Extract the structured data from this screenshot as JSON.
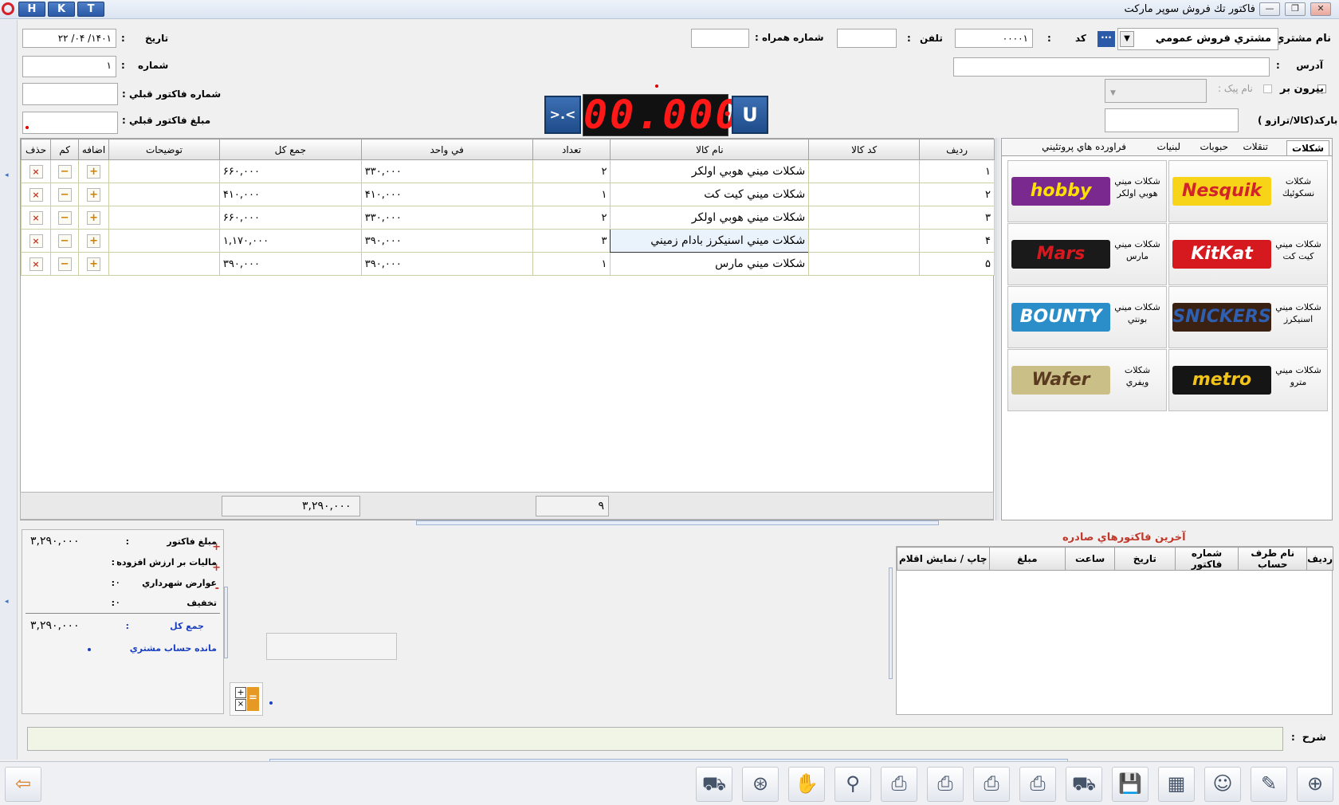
{
  "window": {
    "title": "فاكتور تك فروش سوپر ماركت",
    "hkt_buttons": [
      "H",
      "K",
      "T"
    ]
  },
  "header": {
    "customer_name_label": "نام مشتري :",
    "customer_name_value": "مشتري فروش عمومي",
    "code_label": "كد",
    "code_colon": ":",
    "code_value": "۰۰۰۰۱",
    "phone_label": "تلفن",
    "phone_colon": ":",
    "mobile_label": "شماره همراه :",
    "date_label": "تاريخ",
    "date_colon": ":",
    "date_value": "۱۴۰۱/ ۰۴/ ۲۲",
    "number_label": "شماره",
    "number_colon": ":",
    "number_value": "۱",
    "address_label": "آدرس",
    "address_colon": ":",
    "prev_invoice_number_label": "شماره فاكتور قبلي :",
    "prev_invoice_amount_label": "مبلغ فاكتور قبلي :",
    "outside_label": "بيرون بر",
    "courier_label": "نام پيک :",
    "barcode_label": "باركد(كالا/ترازو )",
    "led_value": "00.000",
    "left_btn_label": ">.<",
    "right_btn_label": "U"
  },
  "grid": {
    "columns": [
      "رديف",
      "كد كالا",
      "نام كالا",
      "تعداد",
      "في واحد",
      "جمع كل",
      "توضيحات",
      "اضافه",
      "كم",
      "حذف"
    ],
    "rows": [
      {
        "row": "۱",
        "code": "",
        "name": "شكلات ميني هوبي اولكر",
        "qty": "۲",
        "unit": "۳۳۰,۰۰۰",
        "total": "۶۶۰,۰۰۰",
        "desc": ""
      },
      {
        "row": "۲",
        "code": "",
        "name": "شكلات ميني كيت كت",
        "qty": "۱",
        "unit": "۴۱۰,۰۰۰",
        "total": "۴۱۰,۰۰۰",
        "desc": ""
      },
      {
        "row": "۳",
        "code": "",
        "name": "شكلات ميني هوبي اولكر",
        "qty": "۲",
        "unit": "۳۳۰,۰۰۰",
        "total": "۶۶۰,۰۰۰",
        "desc": ""
      },
      {
        "row": "۴",
        "code": "",
        "name": "شكلات ميني اسنيكرز بادام زميني",
        "qty": "۳",
        "unit": "۳۹۰,۰۰۰",
        "total": "۱,۱۷۰,۰۰۰",
        "desc": ""
      },
      {
        "row": "۵",
        "code": "",
        "name": "شكلات ميني مارس",
        "qty": "۱",
        "unit": "۳۹۰,۰۰۰",
        "total": "۳۹۰,۰۰۰",
        "desc": ""
      }
    ],
    "plus_glyph": "+",
    "minus_glyph": "−",
    "delete_glyph": "×",
    "footer_qty_total": "۹",
    "footer_amount_total": "۳,۲۹۰,۰۰۰"
  },
  "product_tabs": [
    "شكلات",
    "تنقلات",
    "حبوبات",
    "لبنيات",
    "فراورده هاي پروتئيني"
  ],
  "products": [
    {
      "name": "شكلات نسكوئيك",
      "brand": "Nesquik",
      "color": "#f7d417",
      "text": "#d2232a"
    },
    {
      "name": "شكلات ميني هوبي اولكر",
      "brand": "hobby",
      "color": "#7a2a8f",
      "text": "#ffe100"
    },
    {
      "name": "شكلات ميني كيت كت",
      "brand": "KitKat",
      "color": "#d6181f",
      "text": "#ffffff"
    },
    {
      "name": "شكلات ميني مارس",
      "brand": "Mars",
      "color": "#1a1a1a",
      "text": "#d6181f"
    },
    {
      "name": "شكلات ميني اسنيكرز",
      "brand": "SNICKERS",
      "color": "#3b2112",
      "text": "#2f5fb0"
    },
    {
      "name": "شكلات ميني بونتي",
      "brand": "BOUNTY",
      "color": "#2c8ec9",
      "text": "#ffffff"
    },
    {
      "name": "شكلات ميني مترو",
      "brand": "metro",
      "color": "#151515",
      "text": "#f2c318"
    },
    {
      "name": "شكلات ويفري",
      "brand": "Wafer",
      "color": "#cbbf88",
      "text": "#5a3b20"
    }
  ],
  "totals": {
    "invoice_amount_label": "مبلغ فاكتور",
    "invoice_amount_value": "۳,۲۹۰,۰۰۰",
    "vat_label": "ماليات بر ارزش افزوده",
    "vat_value": "۰",
    "municipal_label": "عوارض شهرداري",
    "municipal_value": "۰",
    "discount_label": "تخفيف",
    "discount_value": "۰",
    "grand_total_label": "جمع كل",
    "grand_total_value": "۳,۲۹۰,۰۰۰",
    "balance_label": "مانده حساب مشتري",
    "colon": ":",
    "plus_sign": "+",
    "minus_sign": "-"
  },
  "latest_invoices": {
    "title": "آخرين فاكتورهاي صادره",
    "columns": [
      "رديف",
      "نام طرف حساب",
      "شماره فاكتور",
      "تاريخ",
      "ساعت",
      "مبلغ",
      "چاپ / نمايش اقلام"
    ]
  },
  "notes": {
    "label": "شرح",
    "colon": ":"
  },
  "colors": {
    "accent_blue": "#2a5aa8",
    "led_red": "#ff1818",
    "invoice_title_red": "#c0392b",
    "total_blue": "#1a3fbf"
  }
}
